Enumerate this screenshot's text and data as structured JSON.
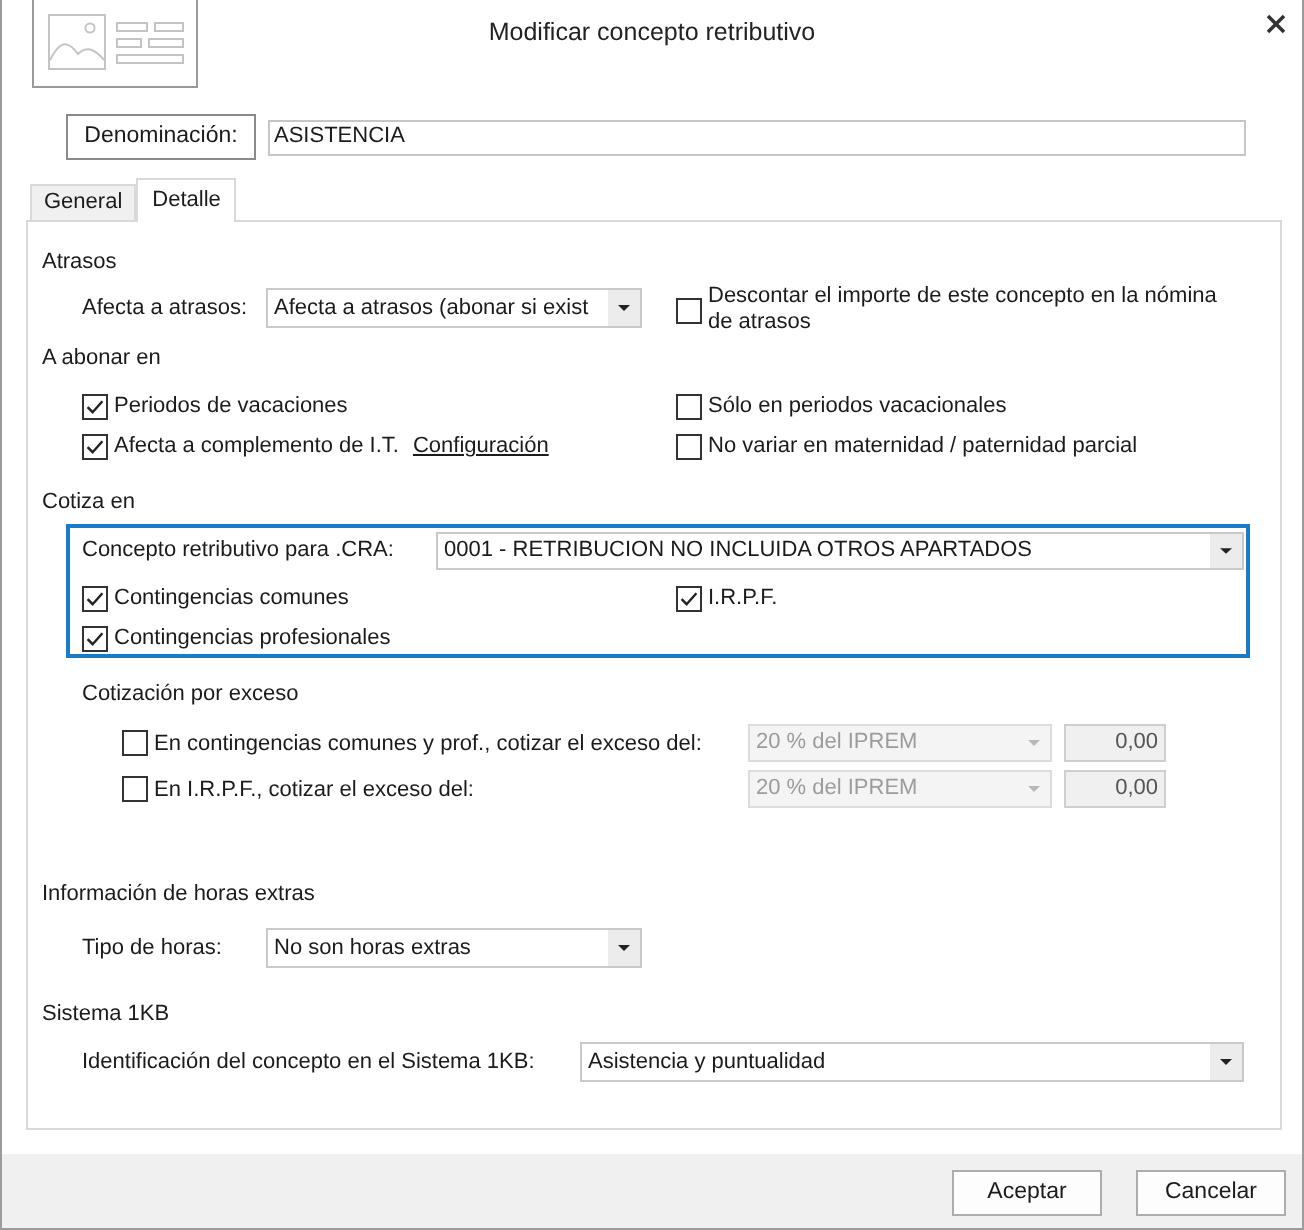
{
  "window": {
    "title": "Modificar concepto retributivo"
  },
  "denominacion": {
    "label": "Denominación:",
    "value": "ASISTENCIA"
  },
  "tabs": [
    {
      "label": "General",
      "selected": false
    },
    {
      "label": "Detalle",
      "selected": true
    }
  ],
  "atrasos": {
    "title": "Atrasos",
    "label": "Afecta a atrasos:",
    "value": "Afecta a atrasos (abonar si exist",
    "option": {
      "label": "Descontar el importe de este concepto en la nómina de atrasos",
      "checked": false
    }
  },
  "a_abonar_en": {
    "title": "A abonar en",
    "options": [
      {
        "label": "Periodos de vacaciones",
        "checked": true
      },
      {
        "label": "Sólo en periodos vacacionales",
        "checked": false
      },
      {
        "label": "Afecta a complemento de I.T.",
        "checked": true,
        "link": "Configuración"
      },
      {
        "label": "No variar en maternidad / paternidad parcial",
        "checked": false
      }
    ]
  },
  "cotiza_en": {
    "title": "Cotiza en",
    "focused": true,
    "cra": {
      "label": "Concepto retributivo para .CRA:",
      "value": "0001 - RETRIBUCION NO INCLUIDA OTROS APARTADOS"
    },
    "options": [
      {
        "label": "Contingencias comunes",
        "checked": true
      },
      {
        "label": "I.R.P.F.",
        "checked": true
      },
      {
        "label": "Contingencias profesionales",
        "checked": true
      }
    ]
  },
  "cotizacion_por_exceso": {
    "title": "Cotización por exceso",
    "rows": [
      {
        "label": "En contingencias comunes y prof., cotizar el exceso del:",
        "checked": false,
        "base": {
          "value": "20 % del IPREM",
          "disabled": true
        },
        "amount": {
          "value": "0,00",
          "disabled": true
        }
      },
      {
        "label": "En I.R.P.F., cotizar el exceso del:",
        "checked": false,
        "base": {
          "value": "20 % del IPREM",
          "disabled": true
        },
        "amount": {
          "value": "0,00",
          "disabled": true
        }
      }
    ]
  },
  "horas_extras": {
    "title": "Información de horas extras",
    "label": "Tipo de horas:",
    "value": "No son horas extras"
  },
  "sistema_1kb": {
    "title": "Sistema 1KB",
    "label": "Identificación del concepto en el Sistema 1KB:",
    "value": "Asistencia y puntualidad"
  },
  "buttons": [
    {
      "label": "Aceptar"
    },
    {
      "label": "Cancelar"
    }
  ]
}
